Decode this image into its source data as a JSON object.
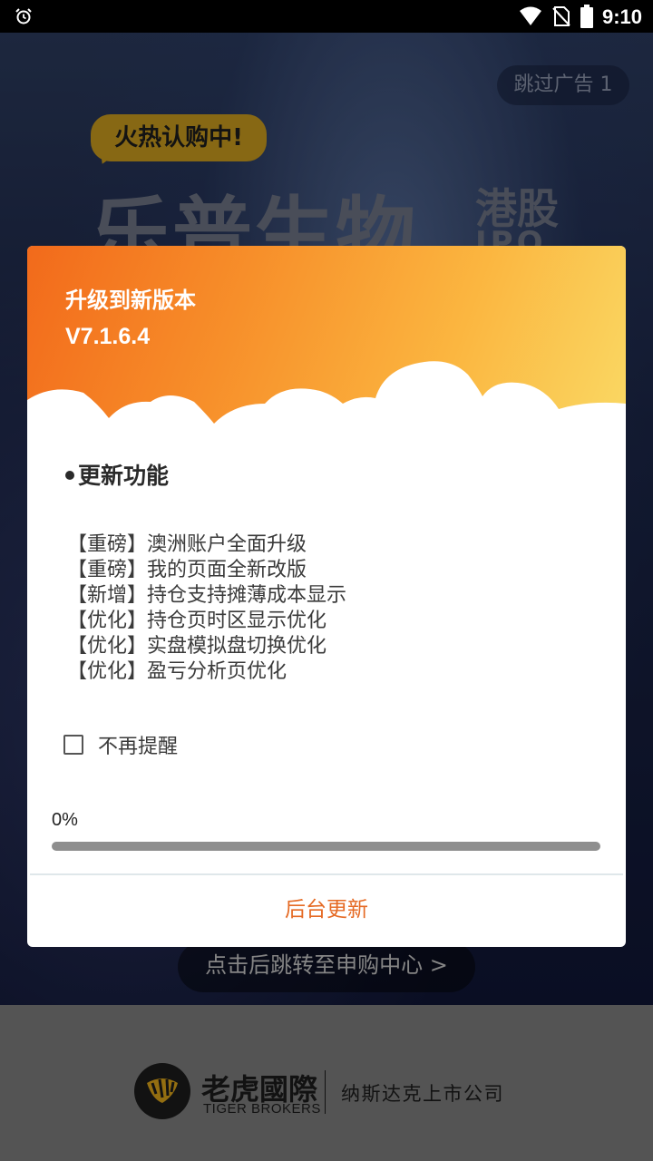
{
  "status_bar": {
    "time": "9:10"
  },
  "ad": {
    "skip_label": "跳过广告 1",
    "hot_badge": "火热认购中!",
    "title": "乐普生物",
    "tag": "港股",
    "tag_sub": "IPO",
    "cta": "点击后跳转至申购中心 >"
  },
  "brand": {
    "name": "老虎國際",
    "name_en": "TIGER BROKERS",
    "tagline": "纳斯达克上市公司"
  },
  "dialog": {
    "title": "升级到新版本",
    "version": "V7.1.6.4",
    "section_title": "更新功能",
    "notes": [
      "【重磅】澳洲账户全面升级",
      "【重磅】我的页面全新改版",
      "【新增】持仓支持摊薄成本显示",
      "【优化】持仓页时区显示优化",
      "【优化】实盘模拟盘切换优化",
      "【优化】盈亏分析页优化"
    ],
    "dont_remind_label": "不再提醒",
    "dont_remind_checked": false,
    "progress_text": "0%",
    "progress_value": 0,
    "background_update_label": "后台更新"
  },
  "colors": {
    "header_gradient_start": "#f26a1b",
    "header_gradient_end": "#fad863",
    "accent": "#e56a24"
  }
}
